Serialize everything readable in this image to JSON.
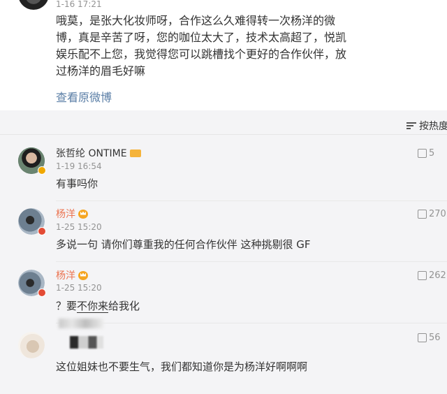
{
  "post": {
    "time": "1-16 17:21",
    "text": "哦莫，是张大化妆师呀，合作这么久难得转一次杨洋的微博，真是辛苦了呀，您的咖位太大了，技术太高超了，悦凯娱乐配不上您，我觉得您可以跳槽找个更好的合作伙伴，放过杨洋的眉毛好嘛",
    "view_original": "查看原微博"
  },
  "sort": {
    "label": "按热度",
    "icon": "sort-lines-icon"
  },
  "comments": [
    {
      "name": "张哲纶 ONTIME",
      "time": "1-19 16:54",
      "text": "有事吗你",
      "likes": "5",
      "badge": "vip-icon",
      "color": "#333333"
    },
    {
      "name": "杨洋",
      "time": "1-25 15:20",
      "text": "多说一句 请你们尊重我的任何合作伙伴 这种挑剔很 GF",
      "likes": "270",
      "badge": "crown-icon",
      "color": "#eb7350"
    },
    {
      "name": "杨洋",
      "time": "1-25 15:20",
      "text_a": "？要",
      "text_b": "不你来",
      "text_c": "给我化",
      "likes": "262",
      "badge": "crown-icon",
      "color": "#eb7350"
    },
    {
      "name": "",
      "time": "",
      "text": "这位姐妹也不要生气，我们都知道你是为杨洋好啊啊啊",
      "likes": "56",
      "badge": "",
      "color": "#333333"
    }
  ],
  "icons": {
    "like": "thumbs-up-icon",
    "verified": "v-badge-icon"
  }
}
